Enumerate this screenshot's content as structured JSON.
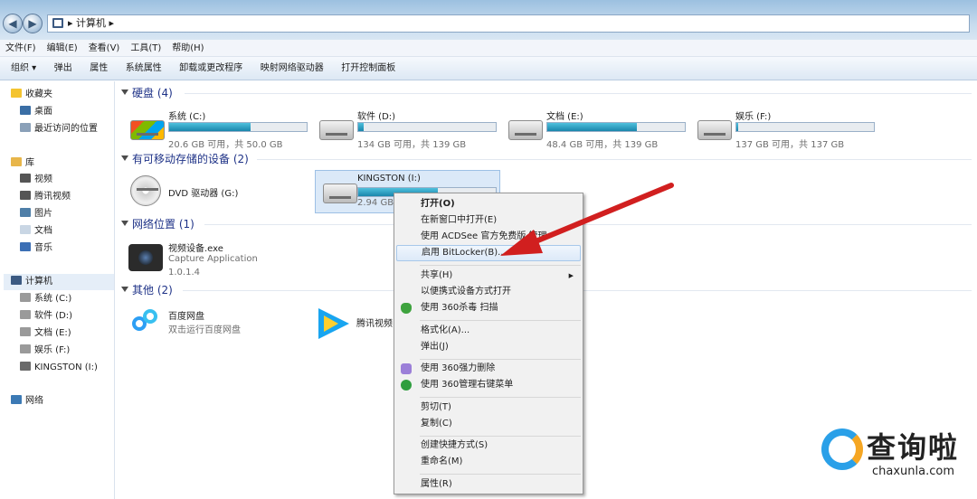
{
  "breadcrumb": {
    "root": "计算机"
  },
  "menu": [
    "文件(F)",
    "编辑(E)",
    "查看(V)",
    "工具(T)",
    "帮助(H)"
  ],
  "toolbar": [
    "组织 ▾",
    "弹出",
    "属性",
    "系统属性",
    "卸载或更改程序",
    "映射网络驱动器",
    "打开控制面板"
  ],
  "sidebar": {
    "favorites": {
      "label": "收藏夹",
      "items": [
        "桌面",
        "最近访问的位置"
      ]
    },
    "libraries": {
      "label": "库",
      "items": [
        "视频",
        "腾讯视频",
        "图片",
        "文档",
        "音乐"
      ]
    },
    "computer": {
      "label": "计算机",
      "items": [
        "系统 (C:)",
        "软件 (D:)",
        "文档 (E:)",
        "娱乐 (F:)",
        "KINGSTON (I:)"
      ]
    },
    "network": {
      "label": "网络"
    }
  },
  "groups": {
    "hdd": "硬盘 (4)",
    "removable": "有可移动存储的设备 (2)",
    "network": "网络位置 (1)",
    "other": "其他 (2)"
  },
  "drives": [
    {
      "name": "系统 (C:)",
      "free": "20.6 GB 可用，共 50.0 GB",
      "used_pct": 59
    },
    {
      "name": "软件 (D:)",
      "free": "134 GB 可用，共 139 GB",
      "used_pct": 4
    },
    {
      "name": "文档 (E:)",
      "free": "48.4 GB 可用，共 139 GB",
      "used_pct": 65
    },
    {
      "name": "娱乐 (F:)",
      "free": "137 GB 可用，共 137 GB",
      "used_pct": 1
    }
  ],
  "removable": [
    {
      "name": "DVD 驱动器 (G:)"
    },
    {
      "name": "KINGSTON (I:)",
      "free": "2.94 GB",
      "used_pct": 58
    }
  ],
  "network_items": [
    {
      "name": "视频设备.exe",
      "line2": "Capture Application",
      "line3": "1.0.1.4"
    }
  ],
  "other_items": [
    {
      "name": "百度网盘",
      "line2": "双击运行百度网盘"
    },
    {
      "name": "腾讯视频"
    }
  ],
  "context_menu": {
    "items": [
      "打开(O)",
      "在新窗口中打开(E)",
      "使用 ACDSee 官方免费版 管理",
      "启用 BitLocker(B)...",
      "共享(H)",
      "以便携式设备方式打开",
      "使用 360杀毒 扫描",
      "格式化(A)...",
      "弹出(J)",
      "使用 360强力删除",
      "使用 360管理右键菜单",
      "剪切(T)",
      "复制(C)",
      "创建快捷方式(S)",
      "重命名(M)",
      "属性(R)"
    ]
  },
  "watermark": {
    "brand": "查询啦",
    "url": "chaxunla.com"
  },
  "colors": {
    "arrow": "#d11f1f",
    "accent": "#1a86ac"
  }
}
